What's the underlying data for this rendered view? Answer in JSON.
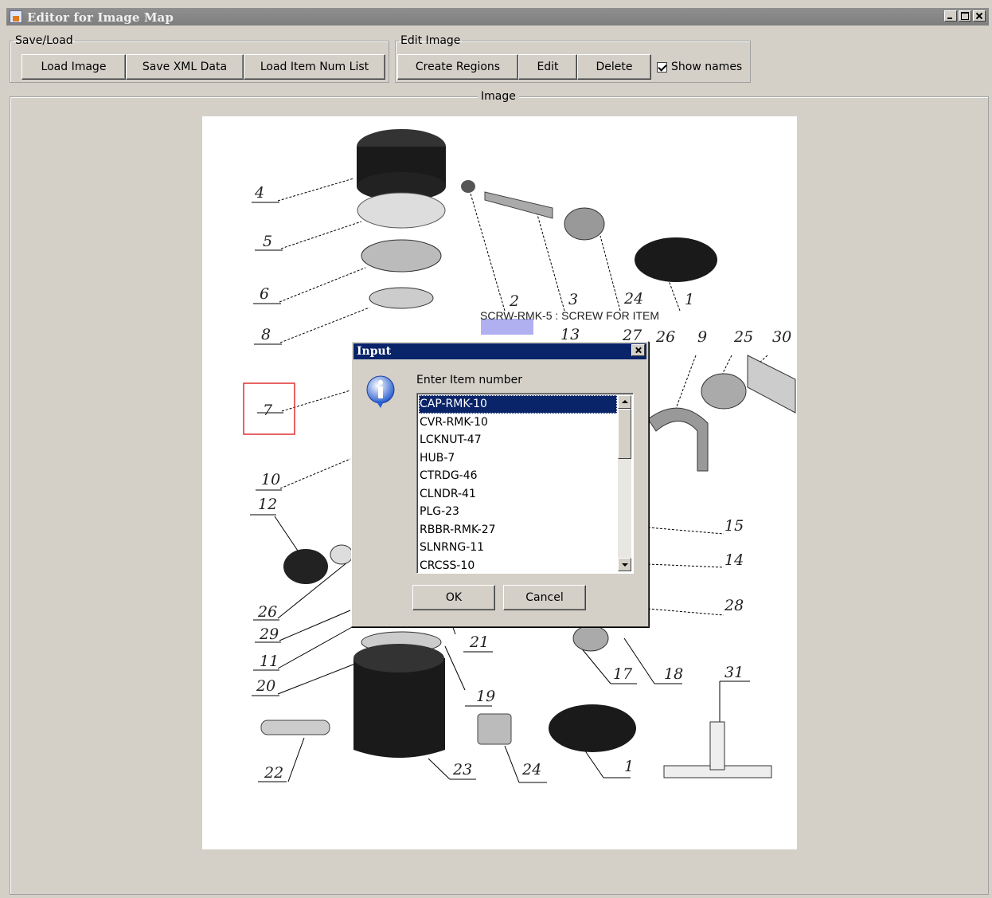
{
  "window": {
    "title": "Editor for Image Map"
  },
  "save_load": {
    "legend": "Save/Load",
    "load_image": "Load Image",
    "save_xml": "Save XML Data",
    "load_item_num_list": "Load Item Num List"
  },
  "edit_image": {
    "legend": "Edit Image",
    "create_regions": "Create Regions",
    "edit": "Edit",
    "delete": "Delete",
    "show_names_label": "Show names",
    "show_names_checked": true
  },
  "image_panel": {
    "title": "Image",
    "region_label": "SCRW-RMK-5 : SCREW FOR ITEM",
    "callouts": [
      "4",
      "5",
      "6",
      "8",
      "7",
      "10",
      "12",
      "26",
      "29",
      "11",
      "20",
      "22",
      "23",
      "24",
      "1",
      "19",
      "21",
      "17",
      "18",
      "31",
      "2",
      "3",
      "24",
      "1",
      "26",
      "13",
      "27",
      "26",
      "9",
      "25",
      "30",
      "15",
      "14",
      "28"
    ]
  },
  "dialog": {
    "title": "Input",
    "prompt": "Enter Item number",
    "items": [
      "CAP-RMK-10",
      "CVR-RMK-10",
      "LCKNUT-47",
      "HUB-7",
      "CTRDG-46",
      "CLNDR-41",
      "PLG-23",
      "RBBR-RMK-27",
      "SLNRNG-11",
      "CRCSS-10"
    ],
    "selected_index": 0,
    "ok": "OK",
    "cancel": "Cancel"
  },
  "colors": {
    "dialog_title_bg": "#0a246a",
    "selection_bg": "#0a246a",
    "highlight_region": "#e03030",
    "region_fill": "#b0b0f0"
  }
}
